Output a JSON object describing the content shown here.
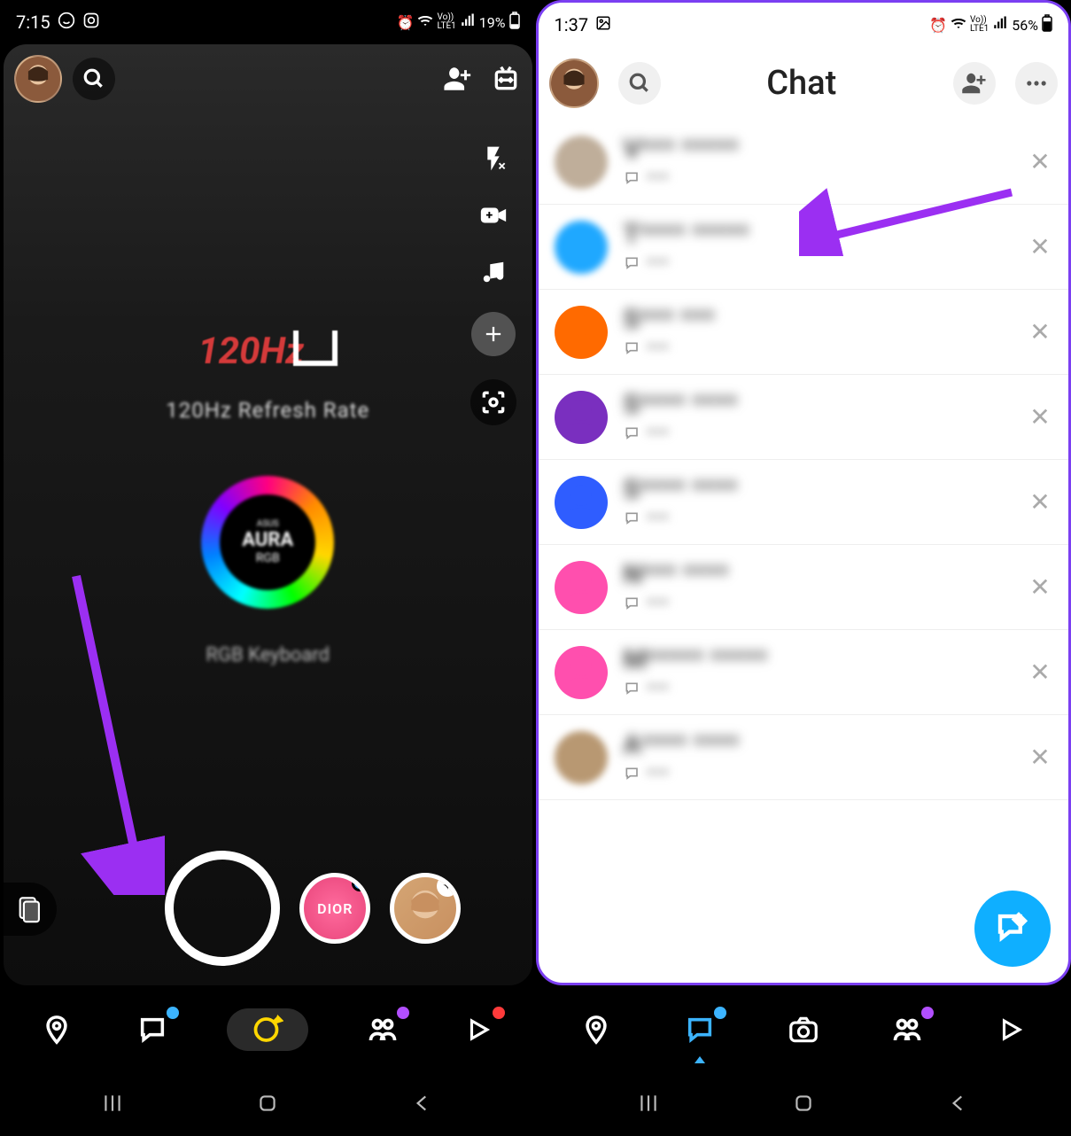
{
  "left": {
    "status": {
      "time": "7:15",
      "battery": "19%"
    },
    "camera_text": {
      "hz": "120Hz",
      "refresh": "120Hz Refresh Rate",
      "aura_brand": "ASUS",
      "aura": "AURA",
      "rgb": "RGB",
      "keyboard": "RGB Keyboard"
    },
    "lens": {
      "dior": "DIOR"
    }
  },
  "right": {
    "status": {
      "time": "1:37",
      "battery": "56%"
    },
    "header": {
      "title": "Chat"
    },
    "chats": [
      {
        "initial": "V",
        "name": "V*** *****",
        "sub": "***",
        "avatar_color": "#bfae9a",
        "blurred_photo": true
      },
      {
        "initial": "T",
        "name": "T**** *****",
        "sub": "***",
        "avatar_color": "#1fa8ff",
        "blurred_photo": true
      },
      {
        "initial": "S",
        "name": "S*** ***",
        "sub": "***",
        "avatar_color": "#ff6a00"
      },
      {
        "initial": "S",
        "name": "S**** ****",
        "sub": "***",
        "avatar_color": "#7a2fbf"
      },
      {
        "initial": "S",
        "name": "S**** ****",
        "sub": "***",
        "avatar_color": "#2f5dff"
      },
      {
        "initial": "N",
        "name": "N*** ****",
        "sub": "***",
        "avatar_color": "#ff4fae"
      },
      {
        "initial": "M",
        "name": "M***** *****",
        "sub": "***",
        "avatar_color": "#ff4fae"
      },
      {
        "initial": "A",
        "name": "A**** ****",
        "sub": "***",
        "avatar_color": "#b89872",
        "blurred_photo": true
      }
    ]
  },
  "colors": {
    "accent_blue": "#3cb4ff",
    "accent_purple": "#b24fff",
    "accent_red": "#ff3b3b",
    "accent_yellow": "#ffd700",
    "fab_blue": "#0fafff",
    "arrow": "#9b2ff2"
  }
}
